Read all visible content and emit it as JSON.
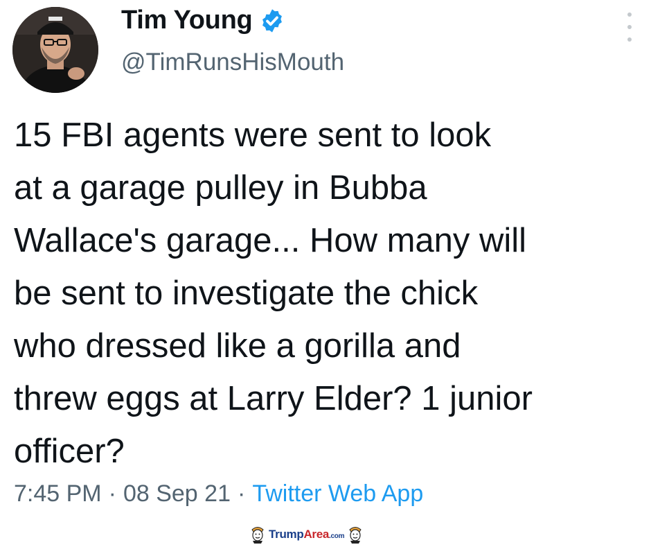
{
  "author": {
    "name": "Tim Young",
    "handle": "@TimRunsHisMouth",
    "verified": true,
    "verified_color": "#1d9bf0",
    "avatar_icon": "profile-photo"
  },
  "tweet": {
    "lines": [
      "15 FBI agents were sent to look",
      "at a garage pulley in Bubba",
      "Wallace's garage... How many will",
      "be sent to investigate the chick",
      "who dressed like a gorilla and",
      "threw eggs at Larry Elder?  1 junior",
      "officer?"
    ]
  },
  "meta": {
    "time": "7:45 PM",
    "date": "08 Sep 21",
    "separator": "·",
    "source": "Twitter Web App",
    "source_color": "#1d9bf0"
  },
  "watermark": {
    "part1": "Trump",
    "part2": "Area",
    "part3": ".com"
  },
  "icons": {
    "more": "more-options-icon",
    "verified": "verified-badge-icon"
  }
}
